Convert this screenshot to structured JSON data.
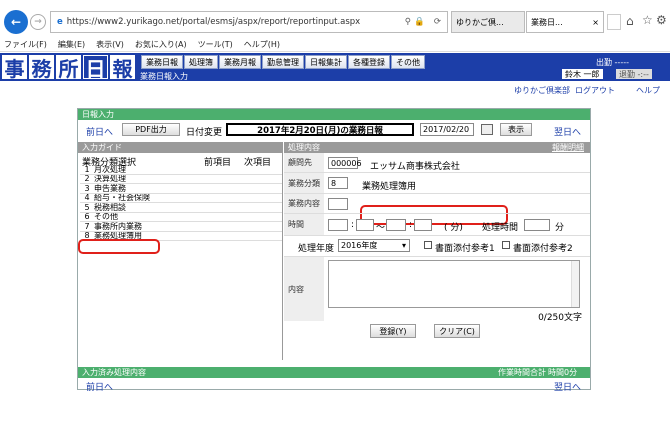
{
  "browser": {
    "url": "https://www2.yurikago.net/portal/esmsj/aspx/report/reportinput.aspx",
    "tab1": "ゆりかご倶...",
    "tab2": "業務日...",
    "menu": [
      "ファイル(F)",
      "編集(E)",
      "表示(V)",
      "お気に入り(A)",
      "ツール(T)",
      "ヘルプ(H)"
    ]
  },
  "app": {
    "logo": [
      "事",
      "務",
      "所",
      "日",
      "報"
    ],
    "subtitle": "業務日報入力",
    "nav": [
      "業務日報",
      "処理簿",
      "業務月報",
      "勤怠管理",
      "日報集計",
      "各種登録",
      "その他"
    ],
    "user_status": "出勤 -----",
    "user_name": "鈴木 一郎",
    "user_return": "退勤 -:--",
    "links": [
      "ゆりかご倶楽部",
      "ログアウト",
      "ヘルプ"
    ]
  },
  "daily": {
    "section": "日報入力",
    "prev": "前日へ",
    "pdf": "PDF出力",
    "date_change": "日付変更",
    "title": "2017年2月20日(月)の業務日報",
    "date_value": "2017/02/20",
    "show": "表示",
    "next": "翌日へ"
  },
  "guide": {
    "header": "入力ガイド",
    "subheader": "業務分類選択",
    "prev_item": "前項目",
    "next_item": "次項目",
    "items": [
      {
        "no": "1",
        "label": "月次処理"
      },
      {
        "no": "2",
        "label": "決算処理"
      },
      {
        "no": "3",
        "label": "申告業務"
      },
      {
        "no": "4",
        "label": "給与・社会保険"
      },
      {
        "no": "5",
        "label": "税務相談"
      },
      {
        "no": "6",
        "label": "その他"
      },
      {
        "no": "7",
        "label": "事務所内業務"
      },
      {
        "no": "8",
        "label": "業務処理簿用"
      }
    ]
  },
  "form": {
    "header": "処理内容",
    "register_link": "報酬明細",
    "client_label": "顧問先",
    "client_code": "000006",
    "client_name": "エッサム商事株式会社",
    "category_label": "業務分類",
    "category_code": "8",
    "category_name": "業務処理簿用",
    "content_label": "業務内容",
    "time_label": "時間",
    "time_sep": "～",
    "time_paren": "( 分)",
    "work_time_label": "処理時間",
    "minute": "分",
    "fiscal_label": "処理年度",
    "fiscal_value": "2016年度",
    "attach1": "書面添付参考1",
    "attach2": "書面添付参考2",
    "body_label": "内容",
    "char_count": "0/250文字",
    "submit": "登録(Y)",
    "clear": "クリア(C)"
  },
  "done": {
    "header": "入力済み処理内容",
    "total_label": "作業時間合計",
    "total_value": "時間0分",
    "prev": "前日へ",
    "next": "翌日へ"
  }
}
